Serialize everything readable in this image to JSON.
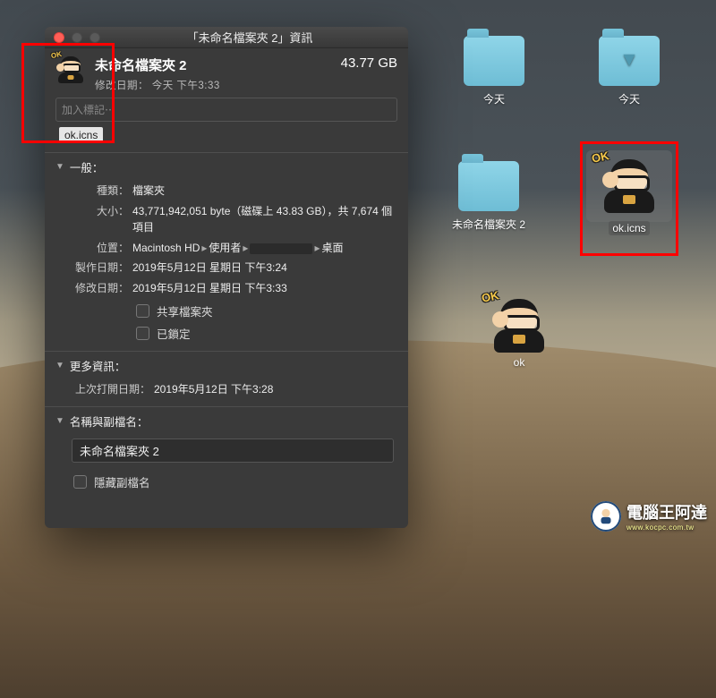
{
  "window": {
    "title": "「未命名檔案夾 2」資訊",
    "name": "未命名檔案夾 2",
    "modified_line": "修改日期： 今天 下午3:33",
    "size_display": "43.77 GB",
    "tags_placeholder": "加入標記⋯",
    "drop_label": "ok.icns"
  },
  "sections": {
    "general": {
      "title": "一般：",
      "kind_label": "種類",
      "kind_value": "檔案夾",
      "size_label": "大小",
      "size_value": "43,771,942,051 byte（磁碟上 43.83 GB），共 7,674 個項目",
      "where_label": "位置",
      "where_value_parts": [
        "Macintosh HD",
        "使用者",
        "",
        "桌面"
      ],
      "created_label": "製作日期",
      "created_value": "2019年5月12日 星期日 下午3:24",
      "modified_label": "修改日期",
      "modified_value": "2019年5月12日 星期日 下午3:33",
      "shared_label": "共享檔案夾",
      "locked_label": "已鎖定"
    },
    "more": {
      "title": "更多資訊：",
      "lastopen_label": "上次打開日期",
      "lastopen_value": "2019年5月12日 下午3:28"
    },
    "nameext": {
      "title": "名稱與副檔名：",
      "value": "未命名檔案夾 2",
      "hide_ext_label": "隱藏副檔名"
    }
  },
  "desktop": {
    "folder_today": "今天",
    "folder_unnamed": "未命名檔案夾 2",
    "ok_icns": "ok.icns",
    "ok_folder": "ok"
  },
  "avatar_ok_text": "OK",
  "watermark": {
    "main": "電腦王阿達",
    "sub": "www.kocpc.com.tw"
  }
}
